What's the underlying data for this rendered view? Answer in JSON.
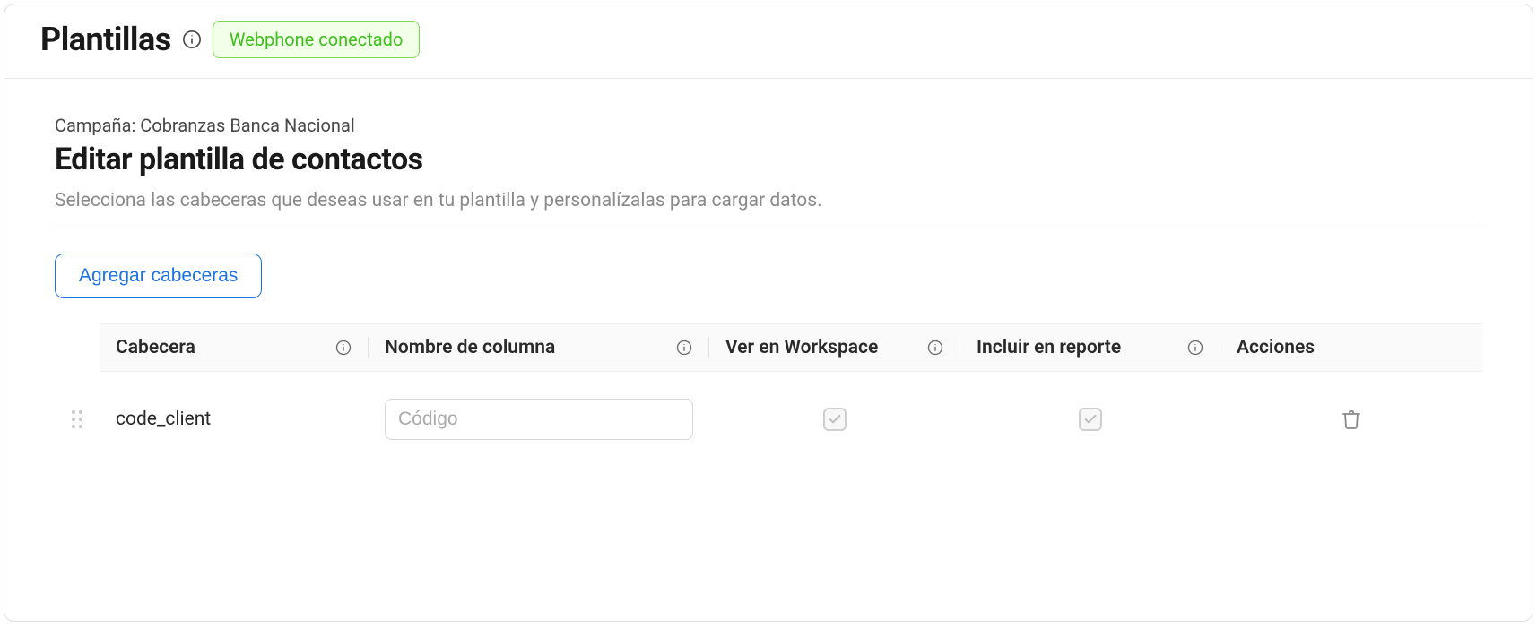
{
  "header": {
    "title": "Plantillas",
    "badge": "Webphone conectado"
  },
  "section": {
    "campaign_label": "Campaña: Cobranzas Banca Nacional",
    "title": "Editar plantilla de contactos",
    "subtitle": "Selecciona las cabeceras que deseas usar en tu plantilla y personalízalas para cargar datos."
  },
  "actions": {
    "add_headers": "Agregar cabeceras"
  },
  "table": {
    "columns": {
      "cabecera": "Cabecera",
      "nombre": "Nombre de columna",
      "workspace": "Ver en Workspace",
      "reporte": "Incluir en reporte",
      "acciones": "Acciones"
    },
    "rows": [
      {
        "cabecera": "code_client",
        "nombre_placeholder": "Código",
        "nombre_value": "",
        "workspace_checked": true,
        "reporte_checked": true
      }
    ]
  }
}
